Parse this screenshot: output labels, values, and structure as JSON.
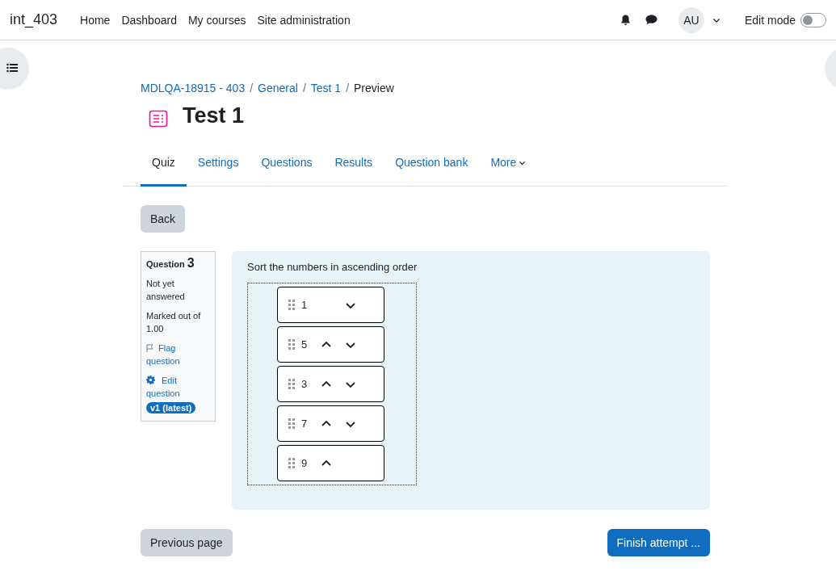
{
  "site_name": "int_403",
  "nav": [
    {
      "label": "Home"
    },
    {
      "label": "Dashboard"
    },
    {
      "label": "My courses"
    },
    {
      "label": "Site administration"
    }
  ],
  "user": {
    "initials": "AU"
  },
  "edit_mode": {
    "label": "Edit mode",
    "on": false
  },
  "breadcrumb": [
    {
      "label": "MDLQA-18915 - 403",
      "link": true
    },
    {
      "label": "General",
      "link": true
    },
    {
      "label": "Test 1",
      "link": true
    },
    {
      "label": "Preview",
      "link": false
    }
  ],
  "breadcrumb_separator": "/",
  "page_title": "Test 1",
  "tabs": [
    {
      "label": "Quiz",
      "selected": true
    },
    {
      "label": "Settings",
      "selected": false
    },
    {
      "label": "Questions",
      "selected": false
    },
    {
      "label": "Results",
      "selected": false
    },
    {
      "label": "Question bank",
      "selected": false
    },
    {
      "label": "More",
      "selected": false
    }
  ],
  "back_button": "Back",
  "question_info": {
    "label": "Question",
    "number": "3",
    "status": "Not yet answered",
    "marks": "Marked out of 1.00",
    "flag": "Flag question",
    "edit": "Edit question",
    "version": "v1 (latest)"
  },
  "question": {
    "text": "Sort the numbers in ascending order",
    "items": [
      {
        "value": "1",
        "up": false,
        "down": true
      },
      {
        "value": "5",
        "up": true,
        "down": true
      },
      {
        "value": "3",
        "up": true,
        "down": true
      },
      {
        "value": "7",
        "up": true,
        "down": true
      },
      {
        "value": "9",
        "up": true,
        "down": false
      }
    ]
  },
  "previous_button": "Previous page",
  "finish_button": "Finish attempt ..."
}
